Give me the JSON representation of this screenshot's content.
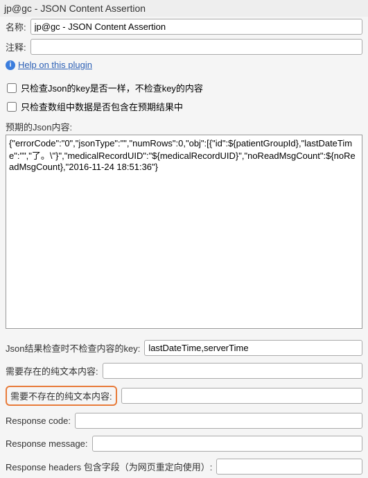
{
  "title": "jp@gc - JSON Content Assertion",
  "name": {
    "label": "名称:",
    "value": "jp@gc - JSON Content Assertion"
  },
  "comment": {
    "label": "注释:",
    "value": ""
  },
  "help": {
    "text": "Help on this plugin"
  },
  "checkbox1": {
    "label": "只检查Json的key是否一样，不检查key的内容"
  },
  "checkbox2": {
    "label": "只检查数组中数据是否包含在预期结果中"
  },
  "expectedJson": {
    "label": "预期的Json内容:",
    "value": "{\"errorCode\":\"0\",\"jsonType\":\"\",\"numRows\":0,\"obj\":[{\"id\":${patientGroupId},\"lastDateTime\":\"\",\"了。\\\"}\",\"medicalRecordUID\":\"${medicalRecordUID}\",\"noReadMsgCount\":${noReadMsgCount},\"2016-11-24 18:51:36\"}"
  },
  "excludeKeys": {
    "label": "Json结果检查时不检查内容的key:",
    "value": "lastDateTime,serverTime"
  },
  "mustExistText": {
    "label": "需要存在的纯文本内容:",
    "value": ""
  },
  "mustNotExistText": {
    "label": "需要不存在的纯文本内容:",
    "value": ""
  },
  "responseCode": {
    "label": "Response code:",
    "value": ""
  },
  "responseMessage": {
    "label": "Response message:",
    "value": ""
  },
  "responseHeaders": {
    "label": "Response headers 包含字段（为网页重定向使用）:",
    "value": ""
  }
}
